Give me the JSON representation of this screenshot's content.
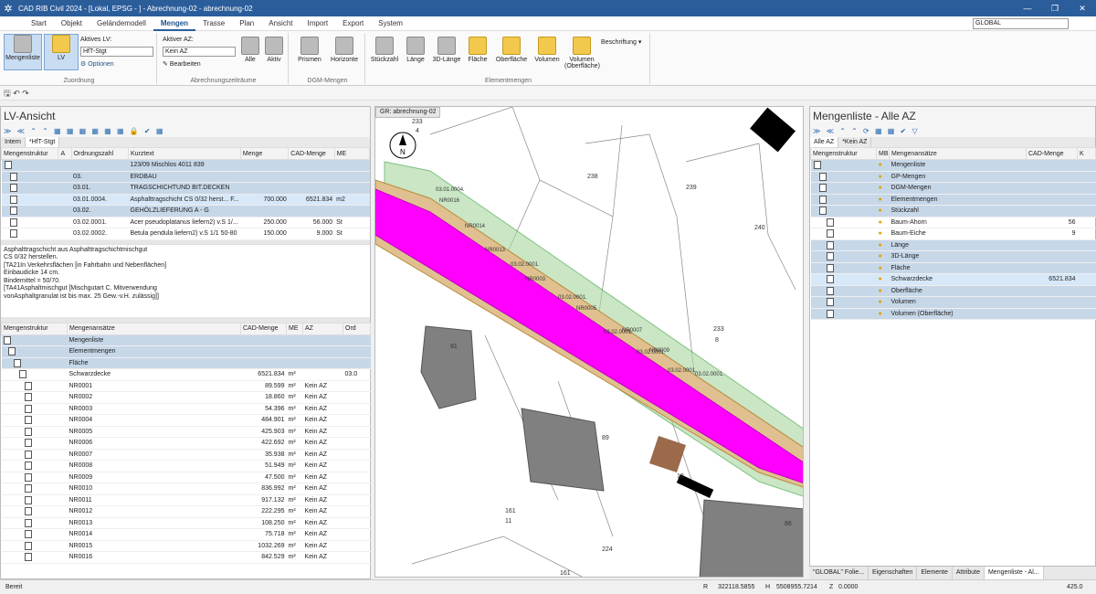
{
  "app": {
    "title": "CAD RIB Civil 2024 - [Lokal, EPSG - ] - Abrechnung-02 - abrechnung-02",
    "global": "GLOBAL"
  },
  "menu": [
    "Start",
    "Objekt",
    "Geländemodell",
    "Mengen",
    "Trasse",
    "Plan",
    "Ansicht",
    "Import",
    "Export",
    "System"
  ],
  "ribbon": {
    "mengenliste": "Mengenliste",
    "lv": "LV",
    "aktives_lv_label": "Aktives LV:",
    "aktives_lv": "HfT-Stgt",
    "optionen": "Optionen",
    "zuordnung": "Zuordnung",
    "aktiver_az_label": "Aktiver AZ:",
    "aktiver_az": "Kein AZ",
    "bearbeiten": "Bearbeiten",
    "alle": "Alle",
    "aktiv": "Aktiv",
    "abrechnungszeitraeume": "Abrechnungszeiträume",
    "prismen": "Prismen",
    "horizonte": "Horizonte",
    "dgm_mengen": "DGM-Mengen",
    "stueckzahl": "Stückzahl",
    "laenge": "Länge",
    "laenge3d": "3D-Länge",
    "flaeche": "Fläche",
    "oberflaeche": "Oberfläche",
    "volumen": "Volumen",
    "volumen_ob": "Volumen (Oberfläche)",
    "elementmengen": "Elementmengen",
    "beschriftung": "Beschriftung"
  },
  "lv": {
    "title": "LV-Ansicht",
    "tabs": [
      "Intern",
      "*HfT-Stgt"
    ],
    "headers": [
      "Mengenstruktur",
      "A",
      "Ordnungszahl",
      "Kurztext",
      "Menge",
      "CAD-Menge",
      "ME"
    ],
    "rows": [
      {
        "oz": "",
        "kt": "123/09 Mischlos 4011 839",
        "m": "",
        "cm": "",
        "me": "",
        "cls": "hl"
      },
      {
        "oz": "03.",
        "kt": "ERDBAU",
        "m": "",
        "cm": "",
        "me": "",
        "cls": "hl"
      },
      {
        "oz": "03.01.",
        "kt": "TRAGSCHICHTUND BIT.DECKEN",
        "m": "",
        "cm": "",
        "me": "",
        "cls": "hl"
      },
      {
        "oz": "03.01.0004.",
        "kt": "Asphalttragschicht CS 0/32 herst... F...",
        "m": "700.000",
        "cm": "6521.834",
        "me": "m2",
        "cls": "sel"
      },
      {
        "oz": "03.02.",
        "kt": "GEHÖLZLIEFERUNG A - G",
        "m": "",
        "cm": "",
        "me": "",
        "cls": "hl"
      },
      {
        "oz": "03.02.0001.",
        "kt": "Acer pseudoplatanus liefern2) v.S 1/...",
        "m": "250.000",
        "cm": "56.000",
        "me": "St",
        "cls": ""
      },
      {
        "oz": "03.02.0002.",
        "kt": "Betula pendula liefern2) v.S 1/1 50-80",
        "m": "150.000",
        "cm": "9.000",
        "me": "St",
        "cls": ""
      }
    ],
    "desc": [
      "Asphalttragschicht aus Asphalttragschichtmischgut",
      "CS 0/32 herstellen.",
      "[TA21In Verkehrsflächen [in Fahrbahn und Nebenflächen]",
      "Einbaudicke 14 cm.",
      "Bindemittel = 50/70.",
      "[TA41Asphaltmischgut [Mischgutart C. Mitverwendung",
      "vonAsphaltgranulat ist bis max. 25 Gew.-v.H. zulässig]]"
    ],
    "lower_headers": [
      "Mengenstruktur",
      "Mengenansätze",
      "CAD-Menge",
      "ME",
      "AZ",
      "Ord"
    ],
    "lower_rows": [
      {
        "n": "Mengenliste",
        "v": "",
        "me": "",
        "az": "",
        "cls": "hl"
      },
      {
        "n": "Elementmengen",
        "v": "",
        "me": "",
        "az": "",
        "cls": "hl"
      },
      {
        "n": "Fläche",
        "v": "",
        "me": "",
        "az": "",
        "cls": "hl"
      },
      {
        "n": "Schwarzdecke",
        "v": "6521.834",
        "me": "m²",
        "az": "",
        "cls": ""
      },
      {
        "n": "NR0001",
        "v": "89.599",
        "me": "m²",
        "az": "Kein AZ",
        "cls": ""
      },
      {
        "n": "NR0002",
        "v": "18.860",
        "me": "m²",
        "az": "Kein AZ",
        "cls": ""
      },
      {
        "n": "NR0003",
        "v": "54.396",
        "me": "m²",
        "az": "Kein AZ",
        "cls": ""
      },
      {
        "n": "NR0004",
        "v": "484.901",
        "me": "m²",
        "az": "Kein AZ",
        "cls": ""
      },
      {
        "n": "NR0005",
        "v": "425.903",
        "me": "m²",
        "az": "Kein AZ",
        "cls": ""
      },
      {
        "n": "NR0006",
        "v": "422.692",
        "me": "m²",
        "az": "Kein AZ",
        "cls": ""
      },
      {
        "n": "NR0007",
        "v": "35.938",
        "me": "m²",
        "az": "Kein AZ",
        "cls": ""
      },
      {
        "n": "NR0008",
        "v": "51.949",
        "me": "m²",
        "az": "Kein AZ",
        "cls": ""
      },
      {
        "n": "NR0009",
        "v": "47.500",
        "me": "m²",
        "az": "Kein AZ",
        "cls": ""
      },
      {
        "n": "NR0010",
        "v": "836.992",
        "me": "m²",
        "az": "Kein AZ",
        "cls": ""
      },
      {
        "n": "NR0011",
        "v": "917.132",
        "me": "m²",
        "az": "Kein AZ",
        "cls": ""
      },
      {
        "n": "NR0012",
        "v": "222.295",
        "me": "m²",
        "az": "Kein AZ",
        "cls": ""
      },
      {
        "n": "NR0013",
        "v": "108.250",
        "me": "m²",
        "az": "Kein AZ",
        "cls": ""
      },
      {
        "n": "NR0014",
        "v": "75.718",
        "me": "m²",
        "az": "Kein AZ",
        "cls": ""
      },
      {
        "n": "NR0015",
        "v": "1032.269",
        "me": "m²",
        "az": "Kein AZ",
        "cls": ""
      },
      {
        "n": "NR0016",
        "v": "842.529",
        "me": "m²",
        "az": "Kein AZ",
        "cls": ""
      }
    ],
    "lower_extra": "03.0"
  },
  "map": {
    "tab": "GR: abrechnung-02",
    "compass": "N",
    "labels": [
      "233",
      "4",
      "238",
      "239",
      "240",
      "233",
      "8",
      "91",
      "89",
      "12",
      "86",
      "161",
      "11",
      "224",
      "161"
    ],
    "road_labels": [
      "03.01.0004.",
      "NR0016",
      "NR0014",
      "NR0013",
      "03.02.0001.",
      "03.02.0001.",
      "03.02.0001.",
      "03.02.0001.",
      "03.02.0001.",
      "03.02.0001.",
      "NR0003",
      "NR0005",
      "NR0007",
      "NR0009"
    ]
  },
  "ml": {
    "title": "Mengenliste - Alle AZ",
    "tabs": [
      "Alle AZ",
      "*Kein AZ"
    ],
    "headers": [
      "Mengenstruktur",
      "MB",
      "Mengenansätze",
      "CAD-Menge",
      "K"
    ],
    "rows": [
      {
        "n": "Mengenliste",
        "v": "",
        "cls": "hl"
      },
      {
        "n": "GP-Mengen",
        "v": "",
        "cls": "hl"
      },
      {
        "n": "DGM-Mengen",
        "v": "",
        "cls": "hl"
      },
      {
        "n": "Elementmengen",
        "v": "",
        "cls": "hl"
      },
      {
        "n": "Stückzahl",
        "v": "",
        "cls": "hl"
      },
      {
        "n": "Baum-Ahorn",
        "v": "56",
        "cls": ""
      },
      {
        "n": "Baum-Eiche",
        "v": "9",
        "cls": ""
      },
      {
        "n": "Länge",
        "v": "",
        "cls": "hl"
      },
      {
        "n": "3D-Länge",
        "v": "",
        "cls": "hl"
      },
      {
        "n": "Fläche",
        "v": "",
        "cls": "hl"
      },
      {
        "n": "Schwarzdecke",
        "v": "6521.834",
        "cls": "sel"
      },
      {
        "n": "Oberfläche",
        "v": "",
        "cls": "hl"
      },
      {
        "n": "Volumen",
        "v": "",
        "cls": "hl"
      },
      {
        "n": "Volumen (Oberfläche)",
        "v": "",
        "cls": "hl"
      }
    ]
  },
  "bottomtabs": [
    "\"GLOBAL\" Folie...",
    "Eigenschaften",
    "Elemente",
    "Attribute",
    "Mengenliste - Al..."
  ],
  "status": {
    "ready": "Bereit",
    "r_label": "R",
    "r": "322118.5855",
    "h_label": "H",
    "h": "5508955.7214",
    "z_label": "Z",
    "z": "0.0000",
    "zoom": "425.0"
  }
}
